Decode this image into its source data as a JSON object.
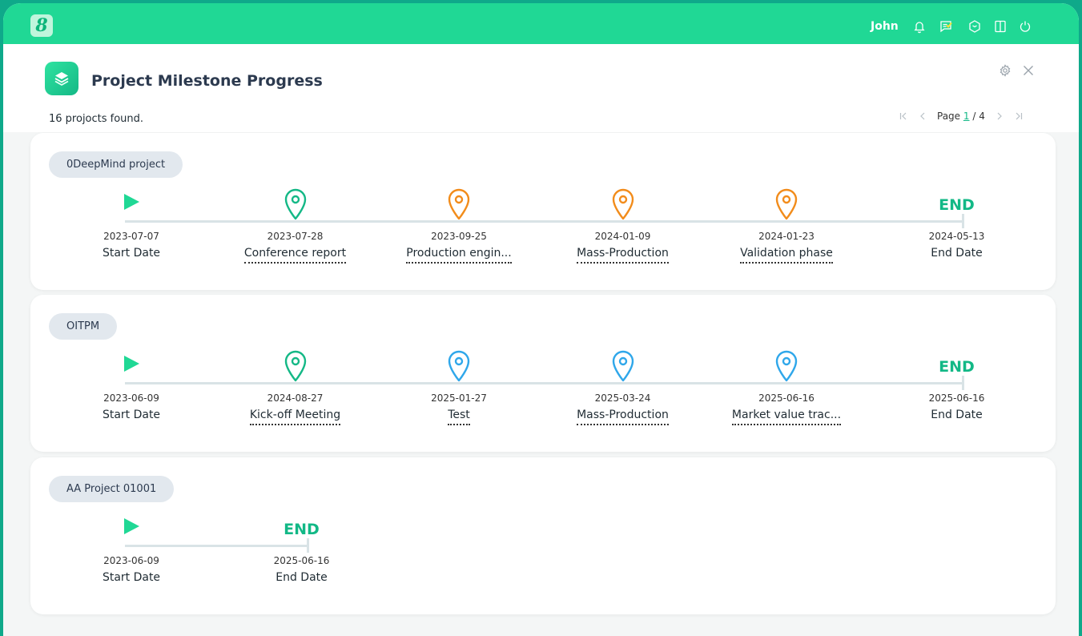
{
  "app": {
    "logo_glyph": "8",
    "user": "John"
  },
  "topbar_icons": [
    "bell-icon",
    "message-check-icon",
    "cube-icon",
    "panel-icon",
    "power-icon"
  ],
  "header": {
    "title": "Project Milestone Progress",
    "count_text": "16 projocts found.",
    "pager": {
      "page_label": "Page",
      "current": "1",
      "separator": "/",
      "total": "4"
    }
  },
  "colors": {
    "accent": "#20d895",
    "done": "#14b886",
    "pending": "#f28c1b",
    "upcoming": "#2fa7ea",
    "track": "#d9e3e6"
  },
  "projects": [
    {
      "name": "0DeepMind project",
      "milestones": [
        {
          "kind": "start",
          "date": "2023-07-07",
          "label": "Start Date"
        },
        {
          "kind": "pin",
          "status": "done",
          "date": "2023-07-28",
          "label": "Conference report"
        },
        {
          "kind": "pin",
          "status": "pending",
          "date": "2023-09-25",
          "label": "Production engin..."
        },
        {
          "kind": "pin",
          "status": "pending",
          "date": "2024-01-09",
          "label": "Mass-Production"
        },
        {
          "kind": "pin",
          "status": "pending",
          "date": "2024-01-23",
          "label": "Validation phase"
        },
        {
          "kind": "end",
          "end_text": "END",
          "date": "2024-05-13",
          "label": "End Date"
        }
      ]
    },
    {
      "name": "OITPM",
      "milestones": [
        {
          "kind": "start",
          "date": "2023-06-09",
          "label": "Start Date"
        },
        {
          "kind": "pin",
          "status": "done",
          "date": "2024-08-27",
          "label": "Kick-off Meeting"
        },
        {
          "kind": "pin",
          "status": "upcoming",
          "date": "2025-01-27",
          "label": "Test"
        },
        {
          "kind": "pin",
          "status": "upcoming",
          "date": "2025-03-24",
          "label": "Mass-Production"
        },
        {
          "kind": "pin",
          "status": "upcoming",
          "date": "2025-06-16",
          "label": "Market value trac..."
        },
        {
          "kind": "end",
          "end_text": "END",
          "date": "2025-06-16",
          "label": "End Date"
        }
      ]
    },
    {
      "name": "AA Project 01001",
      "milestones": [
        {
          "kind": "start",
          "date": "2023-06-09",
          "label": "Start Date"
        },
        {
          "kind": "end",
          "end_text": "END",
          "date": "2025-06-16",
          "label": "End Date"
        }
      ]
    }
  ]
}
